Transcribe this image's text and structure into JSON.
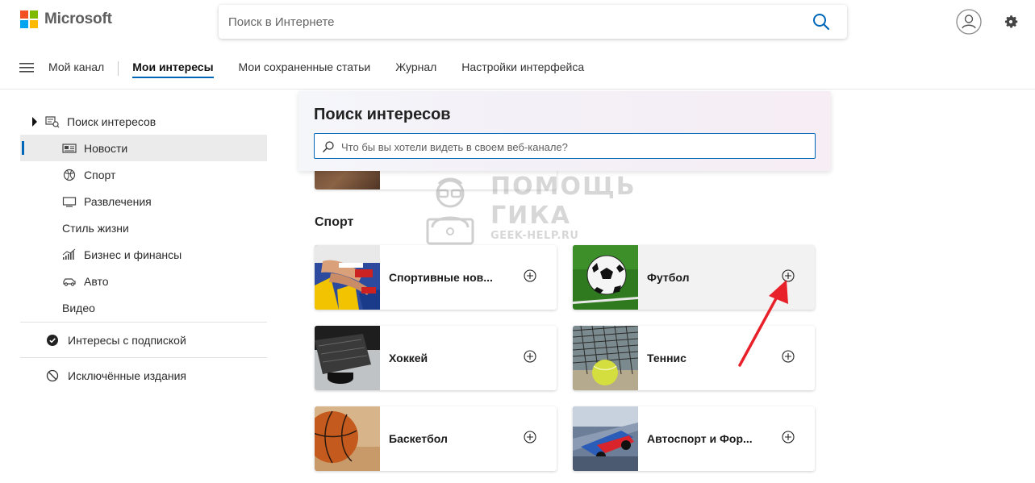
{
  "brand": {
    "name": "Microsoft",
    "colors": [
      "#f25022",
      "#7fba00",
      "#00a4ef",
      "#ffb900"
    ]
  },
  "search": {
    "placeholder": "Поиск в Интернете",
    "icon": "search-icon"
  },
  "nav": {
    "tabs": [
      {
        "label": "Мой канал",
        "active": false
      },
      {
        "label": "Мои интересы",
        "active": true
      },
      {
        "label": "Мои сохраненные статьи",
        "active": false
      },
      {
        "label": "Журнал",
        "active": false
      },
      {
        "label": "Настройки интерфейса",
        "active": false
      }
    ]
  },
  "sidebar": {
    "root_label": "Поиск интересов",
    "items": [
      {
        "label": "Новости",
        "icon": "newspaper-icon",
        "selected": true
      },
      {
        "label": "Спорт",
        "icon": "basketball-icon",
        "selected": false
      },
      {
        "label": "Развлечения",
        "icon": "screen-icon",
        "selected": false
      },
      {
        "label": "Стиль жизни",
        "icon": "",
        "selected": false
      },
      {
        "label": "Бизнес и финансы",
        "icon": "chart-icon",
        "selected": false
      },
      {
        "label": "Авто",
        "icon": "car-icon",
        "selected": false
      },
      {
        "label": "Видео",
        "icon": "",
        "selected": false
      }
    ],
    "subscribed_label": "Интересы с подпиской",
    "excluded_label": "Исключённые издания"
  },
  "panel": {
    "title": "Поиск интересов",
    "placeholder": "Что бы вы хотели видеть в своем веб-канале?"
  },
  "section": {
    "title": "Спорт",
    "cards": [
      {
        "label": "Спортивные нов...",
        "thumb": "sports-news"
      },
      {
        "label": "Футбол",
        "thumb": "football"
      },
      {
        "label": "Хоккей",
        "thumb": "hockey"
      },
      {
        "label": "Теннис",
        "thumb": "tennis"
      },
      {
        "label": "Баскетбол",
        "thumb": "basketball"
      },
      {
        "label": "Автоспорт и Фор...",
        "thumb": "motorsport"
      }
    ]
  },
  "watermark": {
    "line1": "ПОМОЩЬ",
    "line2": "ГИКА",
    "line3": "GEEK-HELP.RU"
  },
  "accent_color": "#0067b8",
  "annotation_color": "#e8202a"
}
